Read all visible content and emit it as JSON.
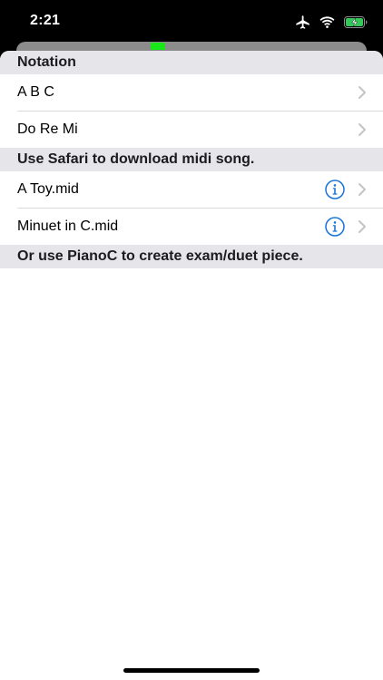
{
  "status_bar": {
    "time": "2:21",
    "icons": [
      "airplane-icon",
      "wifi-icon",
      "battery-charging-icon"
    ]
  },
  "colors": {
    "accent": "#1a73d9",
    "header_bg": "#e5e5ea",
    "indicator_green": "#19e619"
  },
  "sections": [
    {
      "header": "Notation",
      "items": [
        {
          "label": "A B C",
          "has_info": false
        },
        {
          "label": "Do Re Mi",
          "has_info": false
        }
      ]
    },
    {
      "header": "Use Safari to download midi song.",
      "items": [
        {
          "label": "A Toy.mid",
          "has_info": true
        },
        {
          "label": "Minuet in C.mid",
          "has_info": true
        }
      ]
    },
    {
      "header": "Or use PianoC to create exam/duet piece.",
      "items": []
    }
  ]
}
